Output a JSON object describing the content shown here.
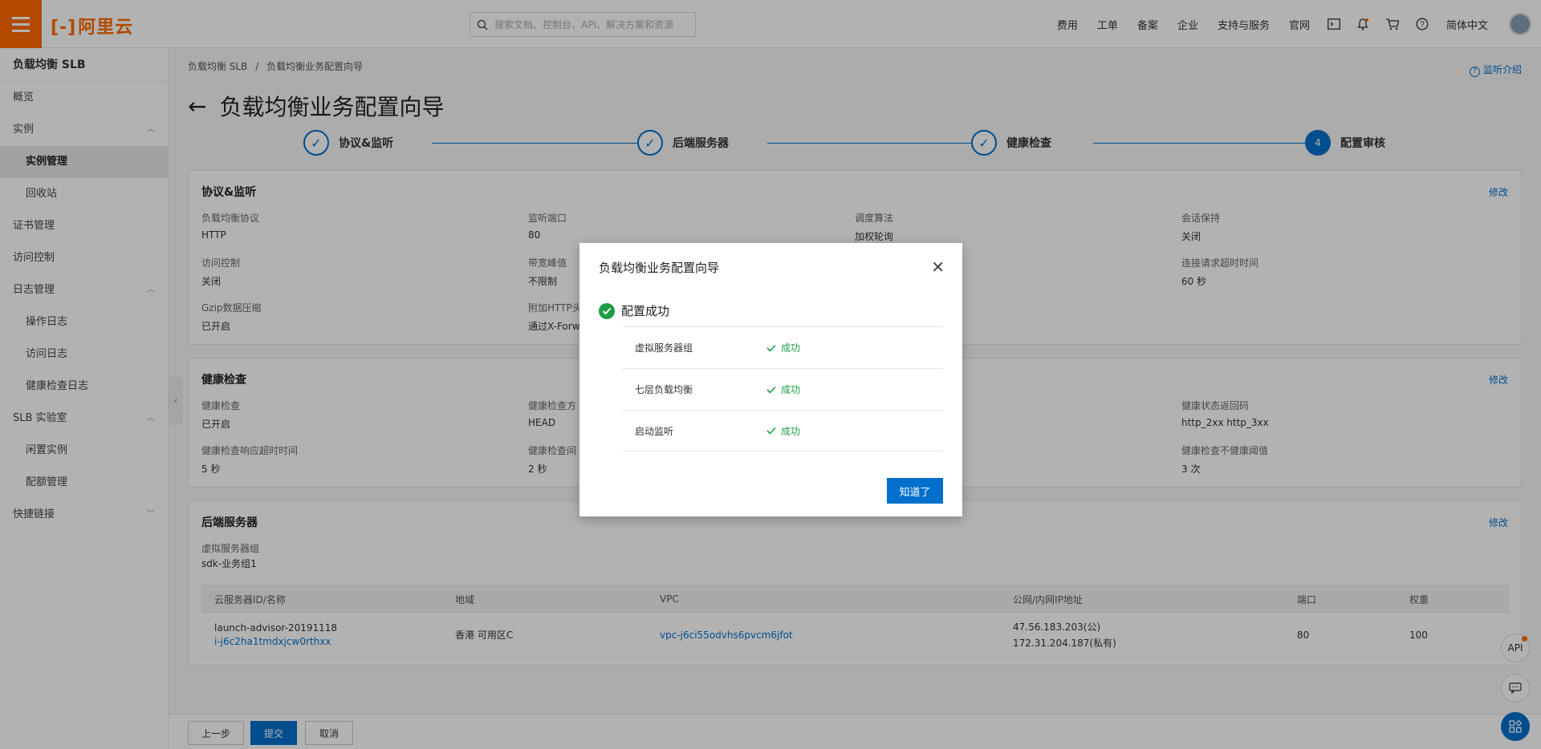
{
  "topbar": {
    "logo_text": "阿里云",
    "search_placeholder": "搜索文档、控制台、API、解决方案和资源",
    "nav": [
      "费用",
      "工单",
      "备案",
      "企业",
      "支持与服务",
      "官网"
    ],
    "language": "简体中文"
  },
  "sidebar": {
    "title": "负载均衡 SLB",
    "items": [
      {
        "label": "概览"
      },
      {
        "label": "实例"
      },
      {
        "label": "实例管理"
      },
      {
        "label": "回收站"
      },
      {
        "label": "证书管理"
      },
      {
        "label": "访问控制"
      },
      {
        "label": "日志管理"
      },
      {
        "label": "操作日志"
      },
      {
        "label": "访问日志"
      },
      {
        "label": "健康检查日志"
      },
      {
        "label": "SLB 实验室"
      },
      {
        "label": "闲置实例"
      },
      {
        "label": "配额管理"
      },
      {
        "label": "快捷链接"
      }
    ]
  },
  "breadcrumb": {
    "root": "负载均衡 SLB",
    "sep": "/",
    "current": "负载均衡业务配置向导"
  },
  "help_link": "监听介绍",
  "page_title": "负载均衡业务配置向导",
  "steps": [
    {
      "label": "协议&监听"
    },
    {
      "label": "后端服务器"
    },
    {
      "label": "健康检查"
    },
    {
      "label": "配置审核",
      "number": "4"
    }
  ],
  "edit_label": "修改",
  "protocol_card": {
    "title": "协议&监听",
    "fields": [
      {
        "k": "负载均衡协议",
        "v": "HTTP"
      },
      {
        "k": "监听端口",
        "v": "80"
      },
      {
        "k": "调度算法",
        "v": "加权轮询"
      },
      {
        "k": "会话保持",
        "v": "关闭"
      },
      {
        "k": "访问控制",
        "v": "关闭"
      },
      {
        "k": "带宽峰值",
        "v": "不限制"
      },
      {
        "k": "连接请求超时时间",
        "v": "60 秒"
      },
      {
        "k": "Gzip数据压缩",
        "v": "已开启"
      },
      {
        "k": "附加HTTP头",
        "v": "通过X-Forw"
      }
    ]
  },
  "health_card": {
    "title": "健康检查",
    "fields": [
      {
        "k": "健康检查",
        "v": "已开启"
      },
      {
        "k": "健康检查方",
        "v": "HEAD"
      },
      {
        "k": "健康状态返回码",
        "v": "http_2xx   http_3xx"
      },
      {
        "k": "健康检查响应超时时间",
        "v": "5 秒"
      },
      {
        "k": "健康检查间",
        "v": "2 秒"
      },
      {
        "k": "健康检查不健康阈值",
        "v": "3 次"
      }
    ]
  },
  "backend_card": {
    "title": "后端服务器",
    "group_label": "虚拟服务器组",
    "group_value": "sdk-业务组1",
    "columns": [
      "云服务器ID/名称",
      "地域",
      "VPC",
      "公网/内网IP地址",
      "端口",
      "权重"
    ],
    "row": {
      "name": "launch-advisor-20191118",
      "id": "i-j6c2ha1tmdxjcw0rthxx",
      "region": "香港 可用区C",
      "vpc": "vpc-j6ci55odvhs6pvcm6jfot",
      "ip_public": "47.56.183.203(公)",
      "ip_private": "172.31.204.187(私有)",
      "port": "80",
      "weight": "100"
    }
  },
  "footer": {
    "prev": "上一步",
    "submit": "提交",
    "cancel": "取消"
  },
  "float": {
    "api": "API"
  },
  "modal": {
    "title": "负载均衡业务配置向导",
    "status": "配置成功",
    "rows": [
      {
        "name": "虚拟服务器组",
        "result": "成功"
      },
      {
        "name": "七层负载均衡",
        "result": "成功"
      },
      {
        "name": "启动监听",
        "result": "成功"
      }
    ],
    "button": "知道了"
  },
  "colors": {
    "brand": "#ff6a00",
    "primary": "#0070cc",
    "success": "#1e9c45"
  }
}
